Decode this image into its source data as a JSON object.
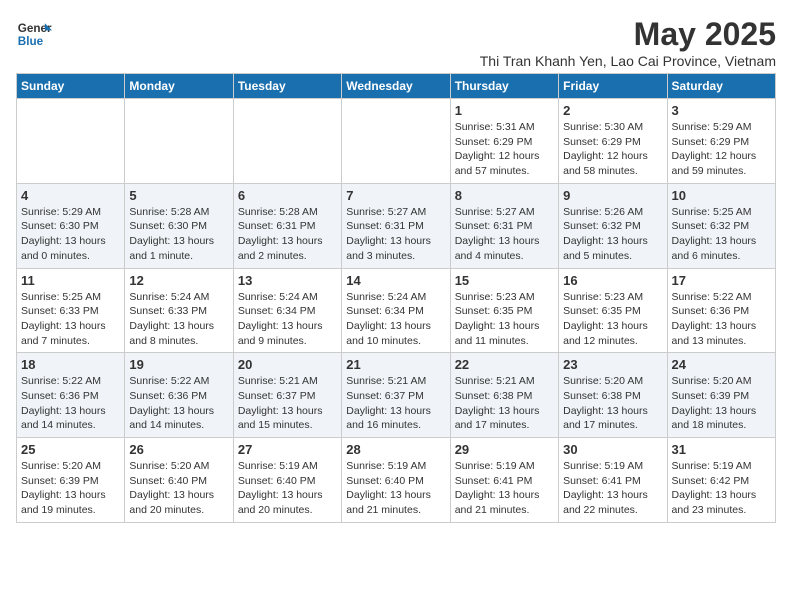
{
  "header": {
    "logo_line1": "General",
    "logo_line2": "Blue",
    "month_title": "May 2025",
    "subtitle": "Thi Tran Khanh Yen, Lao Cai Province, Vietnam"
  },
  "weekdays": [
    "Sunday",
    "Monday",
    "Tuesday",
    "Wednesday",
    "Thursday",
    "Friday",
    "Saturday"
  ],
  "weeks": [
    [
      {
        "day": "",
        "info": ""
      },
      {
        "day": "",
        "info": ""
      },
      {
        "day": "",
        "info": ""
      },
      {
        "day": "",
        "info": ""
      },
      {
        "day": "1",
        "info": "Sunrise: 5:31 AM\nSunset: 6:29 PM\nDaylight: 12 hours\nand 57 minutes."
      },
      {
        "day": "2",
        "info": "Sunrise: 5:30 AM\nSunset: 6:29 PM\nDaylight: 12 hours\nand 58 minutes."
      },
      {
        "day": "3",
        "info": "Sunrise: 5:29 AM\nSunset: 6:29 PM\nDaylight: 12 hours\nand 59 minutes."
      }
    ],
    [
      {
        "day": "4",
        "info": "Sunrise: 5:29 AM\nSunset: 6:30 PM\nDaylight: 13 hours\nand 0 minutes."
      },
      {
        "day": "5",
        "info": "Sunrise: 5:28 AM\nSunset: 6:30 PM\nDaylight: 13 hours\nand 1 minute."
      },
      {
        "day": "6",
        "info": "Sunrise: 5:28 AM\nSunset: 6:31 PM\nDaylight: 13 hours\nand 2 minutes."
      },
      {
        "day": "7",
        "info": "Sunrise: 5:27 AM\nSunset: 6:31 PM\nDaylight: 13 hours\nand 3 minutes."
      },
      {
        "day": "8",
        "info": "Sunrise: 5:27 AM\nSunset: 6:31 PM\nDaylight: 13 hours\nand 4 minutes."
      },
      {
        "day": "9",
        "info": "Sunrise: 5:26 AM\nSunset: 6:32 PM\nDaylight: 13 hours\nand 5 minutes."
      },
      {
        "day": "10",
        "info": "Sunrise: 5:25 AM\nSunset: 6:32 PM\nDaylight: 13 hours\nand 6 minutes."
      }
    ],
    [
      {
        "day": "11",
        "info": "Sunrise: 5:25 AM\nSunset: 6:33 PM\nDaylight: 13 hours\nand 7 minutes."
      },
      {
        "day": "12",
        "info": "Sunrise: 5:24 AM\nSunset: 6:33 PM\nDaylight: 13 hours\nand 8 minutes."
      },
      {
        "day": "13",
        "info": "Sunrise: 5:24 AM\nSunset: 6:34 PM\nDaylight: 13 hours\nand 9 minutes."
      },
      {
        "day": "14",
        "info": "Sunrise: 5:24 AM\nSunset: 6:34 PM\nDaylight: 13 hours\nand 10 minutes."
      },
      {
        "day": "15",
        "info": "Sunrise: 5:23 AM\nSunset: 6:35 PM\nDaylight: 13 hours\nand 11 minutes."
      },
      {
        "day": "16",
        "info": "Sunrise: 5:23 AM\nSunset: 6:35 PM\nDaylight: 13 hours\nand 12 minutes."
      },
      {
        "day": "17",
        "info": "Sunrise: 5:22 AM\nSunset: 6:36 PM\nDaylight: 13 hours\nand 13 minutes."
      }
    ],
    [
      {
        "day": "18",
        "info": "Sunrise: 5:22 AM\nSunset: 6:36 PM\nDaylight: 13 hours\nand 14 minutes."
      },
      {
        "day": "19",
        "info": "Sunrise: 5:22 AM\nSunset: 6:36 PM\nDaylight: 13 hours\nand 14 minutes."
      },
      {
        "day": "20",
        "info": "Sunrise: 5:21 AM\nSunset: 6:37 PM\nDaylight: 13 hours\nand 15 minutes."
      },
      {
        "day": "21",
        "info": "Sunrise: 5:21 AM\nSunset: 6:37 PM\nDaylight: 13 hours\nand 16 minutes."
      },
      {
        "day": "22",
        "info": "Sunrise: 5:21 AM\nSunset: 6:38 PM\nDaylight: 13 hours\nand 17 minutes."
      },
      {
        "day": "23",
        "info": "Sunrise: 5:20 AM\nSunset: 6:38 PM\nDaylight: 13 hours\nand 17 minutes."
      },
      {
        "day": "24",
        "info": "Sunrise: 5:20 AM\nSunset: 6:39 PM\nDaylight: 13 hours\nand 18 minutes."
      }
    ],
    [
      {
        "day": "25",
        "info": "Sunrise: 5:20 AM\nSunset: 6:39 PM\nDaylight: 13 hours\nand 19 minutes."
      },
      {
        "day": "26",
        "info": "Sunrise: 5:20 AM\nSunset: 6:40 PM\nDaylight: 13 hours\nand 20 minutes."
      },
      {
        "day": "27",
        "info": "Sunrise: 5:19 AM\nSunset: 6:40 PM\nDaylight: 13 hours\nand 20 minutes."
      },
      {
        "day": "28",
        "info": "Sunrise: 5:19 AM\nSunset: 6:40 PM\nDaylight: 13 hours\nand 21 minutes."
      },
      {
        "day": "29",
        "info": "Sunrise: 5:19 AM\nSunset: 6:41 PM\nDaylight: 13 hours\nand 21 minutes."
      },
      {
        "day": "30",
        "info": "Sunrise: 5:19 AM\nSunset: 6:41 PM\nDaylight: 13 hours\nand 22 minutes."
      },
      {
        "day": "31",
        "info": "Sunrise: 5:19 AM\nSunset: 6:42 PM\nDaylight: 13 hours\nand 23 minutes."
      }
    ]
  ]
}
